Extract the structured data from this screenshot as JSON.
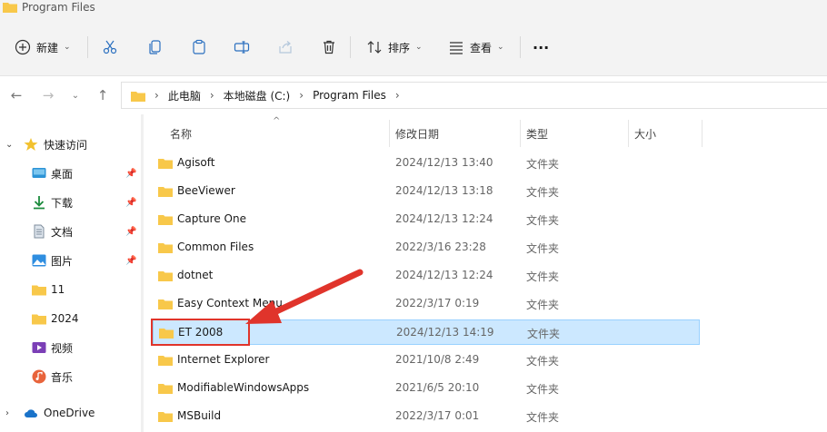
{
  "window": {
    "title": "Program Files"
  },
  "toolbar": {
    "new_label": "新建",
    "sort_label": "排序",
    "view_label": "查看",
    "more_label": "···"
  },
  "address": {
    "crumbs": [
      "此电脑",
      "本地磁盘 (C:)",
      "Program Files"
    ]
  },
  "nav": {
    "quick_access": "快速访问",
    "items": [
      {
        "label": "桌面",
        "icon": "desktop-icon",
        "pinned": true
      },
      {
        "label": "下载",
        "icon": "download-icon",
        "pinned": true
      },
      {
        "label": "文档",
        "icon": "document-icon",
        "pinned": true
      },
      {
        "label": "图片",
        "icon": "pictures-icon",
        "pinned": true
      },
      {
        "label": "11",
        "icon": "folder-icon",
        "pinned": false
      },
      {
        "label": "2024",
        "icon": "folder-icon",
        "pinned": false
      },
      {
        "label": "视频",
        "icon": "video-icon",
        "pinned": false
      },
      {
        "label": "音乐",
        "icon": "music-icon",
        "pinned": false
      }
    ],
    "onedrive": "OneDrive"
  },
  "columns": {
    "name": "名称",
    "date": "修改日期",
    "type": "类型",
    "size": "大小"
  },
  "files": [
    {
      "name": "Agisoft",
      "date": "2024/12/13 13:40",
      "type": "文件夹"
    },
    {
      "name": "BeeViewer",
      "date": "2024/12/13 13:18",
      "type": "文件夹"
    },
    {
      "name": "Capture One",
      "date": "2024/12/13 12:24",
      "type": "文件夹"
    },
    {
      "name": "Common Files",
      "date": "2022/3/16 23:28",
      "type": "文件夹"
    },
    {
      "name": "dotnet",
      "date": "2024/12/13 12:24",
      "type": "文件夹"
    },
    {
      "name": "Easy Context Menu",
      "date": "2022/3/17 0:19",
      "type": "文件夹"
    },
    {
      "name": "ET 2008",
      "date": "2024/12/13 14:19",
      "type": "文件夹",
      "selected": true
    },
    {
      "name": "Internet Explorer",
      "date": "2021/10/8 2:49",
      "type": "文件夹"
    },
    {
      "name": "ModifiableWindowsApps",
      "date": "2021/6/5 20:10",
      "type": "文件夹"
    },
    {
      "name": "MSBuild",
      "date": "2022/3/17 0:01",
      "type": "文件夹"
    }
  ],
  "colors": {
    "folder": "#f8c84a",
    "selection": "#cce8ff",
    "annotation": "#e0342b",
    "accent": "#0067c0"
  }
}
